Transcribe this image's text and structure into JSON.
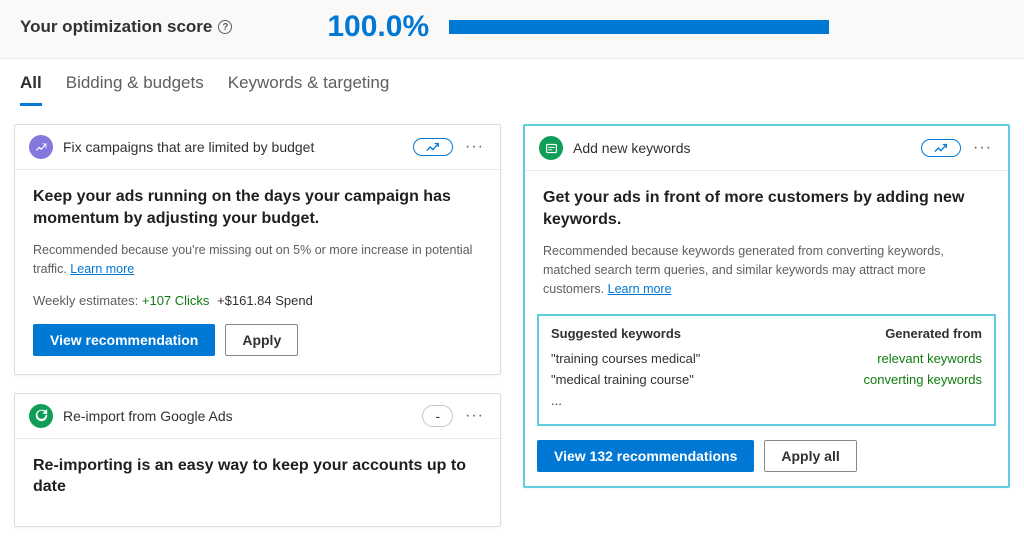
{
  "score": {
    "label": "Your optimization score",
    "value": "100.0%"
  },
  "tabs": [
    {
      "label": "All",
      "active": true
    },
    {
      "label": "Bidding & budgets",
      "active": false
    },
    {
      "label": "Keywords & targeting",
      "active": false
    }
  ],
  "cards": {
    "budget": {
      "title": "Fix campaigns that are limited by budget",
      "headline": "Keep your ads running on the days your campaign has momentum by adjusting your budget.",
      "reason": "Recommended because you're missing out on 5% or more increase in potential traffic.",
      "learn_more": "Learn more",
      "est_label": "Weekly estimates:",
      "est_clicks": "+107 Clicks",
      "est_spend": "+$161.84 Spend",
      "primary_btn": "View recommendation",
      "secondary_btn": "Apply"
    },
    "reimport": {
      "title": "Re-import from Google Ads",
      "badge": "-",
      "headline": "Re-importing is an easy way to keep your accounts up to date"
    },
    "keywords": {
      "title": "Add new keywords",
      "headline": "Get your ads in front of more customers by adding new keywords.",
      "reason": "Recommended because keywords generated from converting keywords, matched search term queries, and similar keywords may attract more customers.",
      "learn_more": "Learn more",
      "suggested_head": "Suggested keywords",
      "generated_head": "Generated from",
      "rows": [
        {
          "term": "\"training courses medical\"",
          "src": "relevant keywords"
        },
        {
          "term": "\"medical training course\"",
          "src": "converting keywords"
        },
        {
          "term": "...",
          "src": ""
        }
      ],
      "primary_btn": "View 132 recommendations",
      "secondary_btn": "Apply all"
    }
  }
}
